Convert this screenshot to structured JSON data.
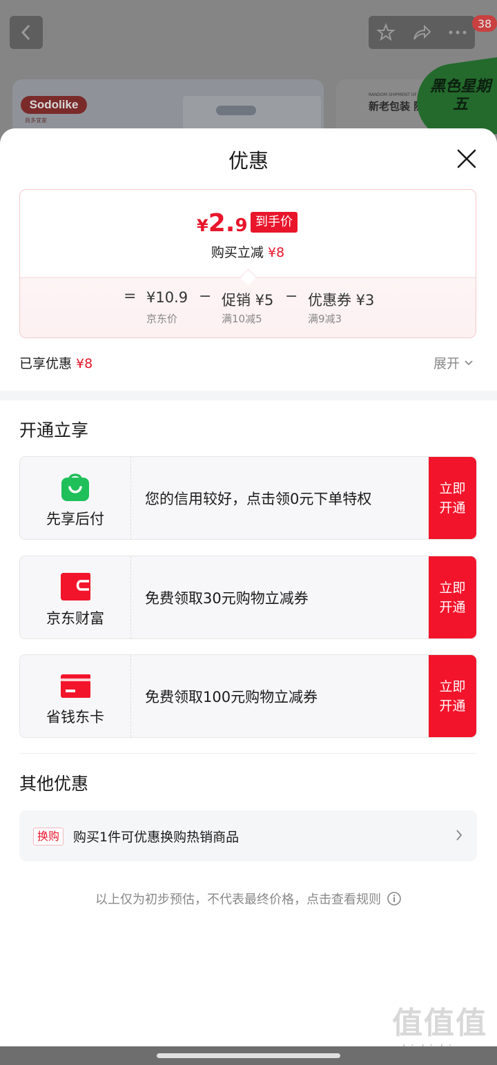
{
  "background": {
    "cart_badge": "38",
    "brand_logo": "Sodolike",
    "brand_sub": "尚多宜家",
    "card2_small": "RANDOM SHIPMENT OF NEW",
    "card2_text": "新老包装 随",
    "promo": "黑色星期五"
  },
  "sheet": {
    "title": "优惠"
  },
  "price": {
    "yen": "¥",
    "int": "2.",
    "dec": "9",
    "tag": "到手价",
    "instant_label": "购买立减",
    "instant_value": "¥8",
    "equals": "=",
    "jd_price": "¥10.9",
    "jd_label": "京东价",
    "minus1": "−",
    "promo_price": "促销 ¥5",
    "promo_label": "满10减5",
    "minus2": "−",
    "coupon_price": "优惠券 ¥3",
    "coupon_label": "满9减3"
  },
  "enjoyed": {
    "label": "已享优惠",
    "value": "¥8",
    "expand": "展开"
  },
  "open_section": {
    "title": "开通立享",
    "offers": [
      {
        "name": "先享后付",
        "desc": "您的信用较好，点击领0元下单特权",
        "button": "立即开通",
        "icon": "bag-icon"
      },
      {
        "name": "京东财富",
        "desc": "免费领取30元购物立减券",
        "button": "立即开通",
        "icon": "wallet-icon"
      },
      {
        "name": "省钱东卡",
        "desc": "免费领取100元购物立减券",
        "button": "立即开通",
        "icon": "card-icon"
      }
    ]
  },
  "other_section": {
    "title": "其他优惠",
    "tag": "换购",
    "text": "购买1件可优惠换购热销商品"
  },
  "note": "以上仅为初步预估，不代表最终价格，点击查看规则",
  "watermark": {
    "big": "值值值",
    "small": "zhizhizhi.com"
  },
  "colors": {
    "accent": "#e8152b",
    "button": "#f2142b",
    "green": "#1fc05a"
  }
}
